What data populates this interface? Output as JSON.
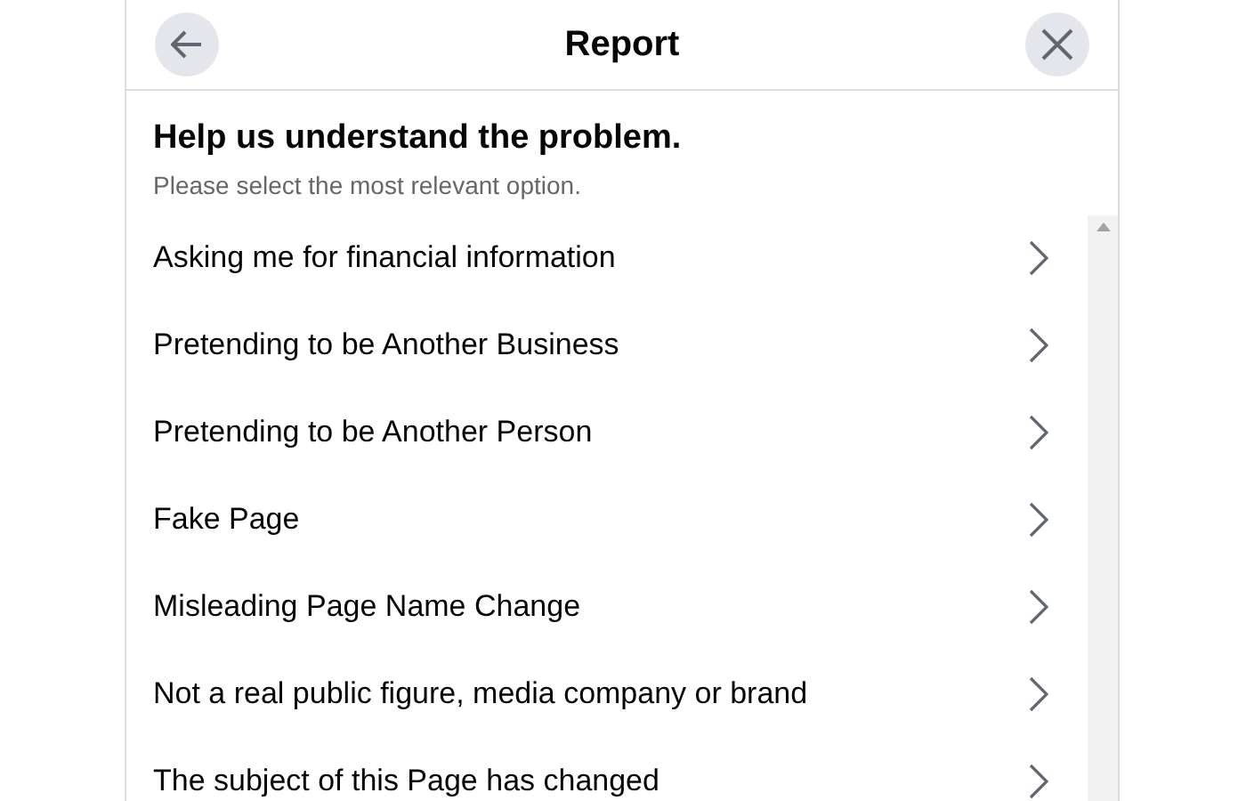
{
  "header": {
    "title": "Report"
  },
  "heading": "Help us understand the problem.",
  "subheading": "Please select the most relevant option.",
  "options": [
    {
      "label": "Asking me for financial information"
    },
    {
      "label": "Pretending to be Another Business"
    },
    {
      "label": "Pretending to be Another Person"
    },
    {
      "label": "Fake Page"
    },
    {
      "label": "Misleading Page Name Change"
    },
    {
      "label": "Not a real public figure, media company or brand"
    },
    {
      "label": "The subject of this Page has changed"
    }
  ]
}
